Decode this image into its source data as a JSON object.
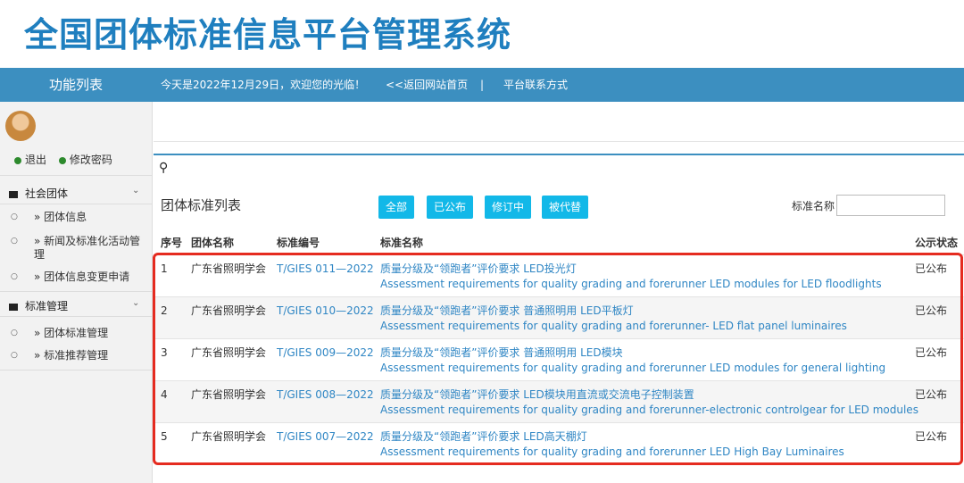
{
  "header": {
    "title": "全国团体标准信息平台管理系统"
  },
  "topbar": {
    "side_title": "功能列表",
    "greeting": "今天是2022年12月29日，欢迎您的光临！",
    "back_link": "<<返回网站首页",
    "separator": "|",
    "contact_link": "平台联系方式"
  },
  "sidebar": {
    "logout": "退出",
    "change_password": "修改密码",
    "groups": [
      {
        "label": "社会团体",
        "items": [
          "» 团体信息",
          "» 新闻及标准化活动管理",
          "» 团体信息变更申请"
        ]
      },
      {
        "label": "标准管理",
        "items": [
          "» 团体标准管理",
          "» 标准推荐管理"
        ]
      }
    ]
  },
  "main": {
    "list_title": "团体标准列表",
    "filters": [
      "全部",
      "已公布",
      "修订中",
      "被代替"
    ],
    "search_label": "标准名称",
    "search_value": "",
    "columns": [
      "序号",
      "团体名称",
      "标准编号",
      "标准名称",
      "公示状态"
    ],
    "rows": [
      {
        "no": "1",
        "org": "广东省照明学会",
        "code": "T/GIES 011—2022",
        "name_cn": "质量分级及“领跑者”评价要求 LED投光灯",
        "name_en": "Assessment requirements for quality grading and forerunner LED modules for LED floodlights",
        "status": "已公布"
      },
      {
        "no": "2",
        "org": "广东省照明学会",
        "code": "T/GIES 010—2022",
        "name_cn": "质量分级及“领跑者”评价要求 普通照明用 LED平板灯",
        "name_en": "Assessment requirements for quality grading and forerunner- LED flat panel luminaires",
        "status": "已公布"
      },
      {
        "no": "3",
        "org": "广东省照明学会",
        "code": "T/GIES 009—2022",
        "name_cn": "质量分级及“领跑者”评价要求 普通照明用 LED模块",
        "name_en": "Assessment requirements for quality grading and forerunner LED modules for general lighting",
        "status": "已公布"
      },
      {
        "no": "4",
        "org": "广东省照明学会",
        "code": "T/GIES 008—2022",
        "name_cn": "质量分级及“领跑者”评价要求 LED模块用直流或交流电子控制装置",
        "name_en": "Assessment requirements for quality grading and forerunner-electronic controlgear for LED modules",
        "status": "已公布"
      },
      {
        "no": "5",
        "org": "广东省照明学会",
        "code": "T/GIES 007—2022",
        "name_cn": "质量分级及“领跑者”评价要求 LED高天棚灯",
        "name_en": "Assessment requirements for quality grading and forerunner LED High Bay Luminaires",
        "status": "已公布"
      }
    ]
  },
  "colors": {
    "accent": "#3c8fc0",
    "title": "#1f7fbf",
    "button": "#12b8e8",
    "link": "#2f86c4",
    "highlight": "#e52b20"
  }
}
